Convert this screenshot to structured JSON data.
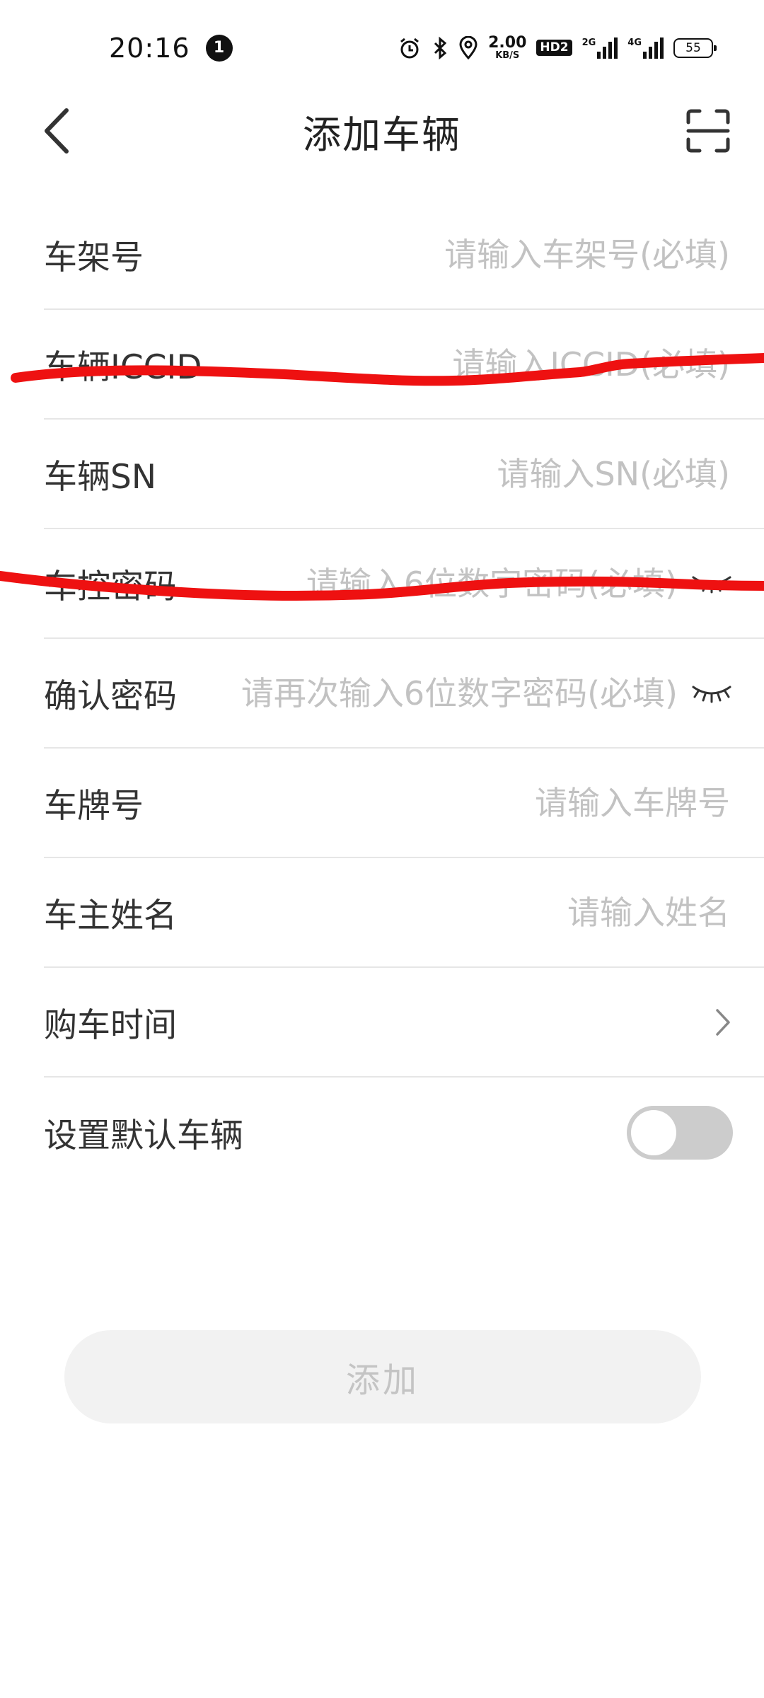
{
  "status_bar": {
    "time": "20:16",
    "notification_count": "1",
    "speed_value": "2.00",
    "speed_unit": "KB/S",
    "hd_label": "HD2",
    "net1_label": "2G",
    "net2_label": "4G",
    "battery_level": "55"
  },
  "header": {
    "title": "添加车辆",
    "back_icon": "chevron-left-icon",
    "scan_icon": "scan-icon"
  },
  "form": {
    "fields": [
      {
        "label": "车架号",
        "placeholder": "请输入车架号(必填)",
        "value": ""
      },
      {
        "label": "车辆ICCID",
        "placeholder": "请输入ICCID(必填)",
        "value": ""
      },
      {
        "label": "车辆SN",
        "placeholder": "请输入SN(必填)",
        "value": ""
      },
      {
        "label": "车控密码",
        "placeholder": "请输入6位数字密码(必填)",
        "value": "",
        "icon": "eye-closed-icon"
      },
      {
        "label": "确认密码",
        "placeholder": "请再次输入6位数字密码(必填)",
        "value": "",
        "icon": "eye-closed-icon"
      },
      {
        "label": "车牌号",
        "placeholder": "请输入车牌号",
        "value": ""
      },
      {
        "label": "车主姓名",
        "placeholder": "请输入姓名",
        "value": ""
      }
    ],
    "purchase_time": {
      "label": "购车时间",
      "icon": "chevron-right-icon"
    },
    "default_vehicle": {
      "label": "设置默认车辆",
      "enabled": false
    }
  },
  "submit": {
    "label": "添加"
  },
  "colors": {
    "placeholder": "#c2c2c2",
    "divider": "#e6e6e6",
    "toggle_off": "#cccccc",
    "button_bg": "#f2f2f2",
    "button_text": "#c4c4c4",
    "annotation": "#ee1111"
  }
}
